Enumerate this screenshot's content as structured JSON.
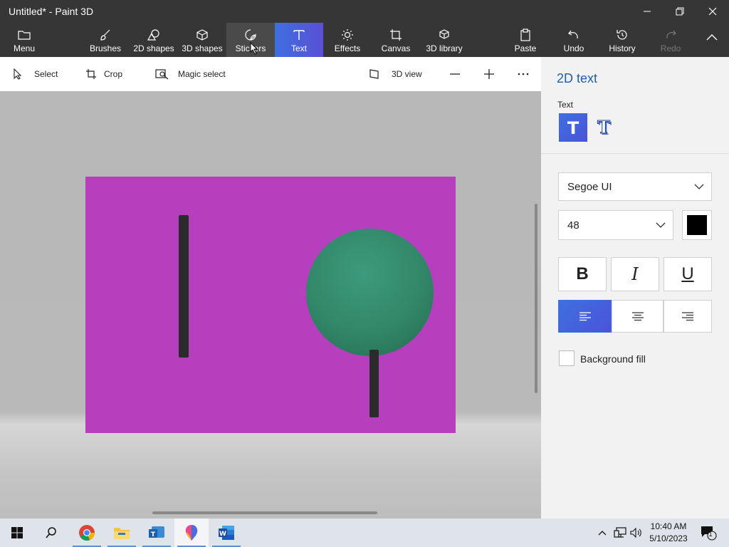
{
  "window": {
    "title": "Untitled* - Paint 3D"
  },
  "ribbon": {
    "menu": "Menu",
    "items": [
      {
        "label": "Brushes"
      },
      {
        "label": "2D shapes"
      },
      {
        "label": "3D shapes"
      },
      {
        "label": "Stickers"
      },
      {
        "label": "Text"
      },
      {
        "label": "Effects"
      },
      {
        "label": "Canvas"
      },
      {
        "label": "3D library"
      }
    ],
    "actions": [
      {
        "label": "Paste"
      },
      {
        "label": "Undo"
      },
      {
        "label": "History"
      },
      {
        "label": "Redo"
      }
    ]
  },
  "toolbar": {
    "select": "Select",
    "crop": "Crop",
    "magic_select": "Magic select",
    "view_3d": "3D view"
  },
  "canvas": {
    "background": "#b63fbe",
    "shape_green": "#328768",
    "stick_color": "#2b2b2b"
  },
  "panel": {
    "title": "2D text",
    "text_label": "Text",
    "font": "Segoe UI",
    "size": "48",
    "color": "#000000",
    "bold": "B",
    "italic": "I",
    "underline": "U",
    "background_fill": "Background fill"
  },
  "taskbar": {
    "time": "10:40 AM",
    "date": "5/10/2023",
    "notification_count": "1"
  },
  "colors": {
    "accent": "#3f6fe0",
    "ribbon_bg": "#363636",
    "panel_title": "#1d5fa8"
  }
}
